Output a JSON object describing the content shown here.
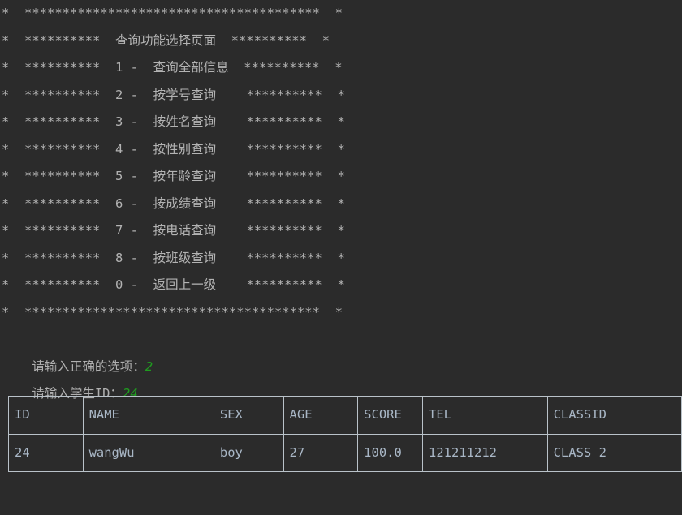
{
  "console": {
    "theme": {
      "background": "#2b2b2b",
      "foreground": "#b3b3b3",
      "input_value_color": "#1f9c1f",
      "table_border_color": "#b9c2c9"
    },
    "border_top": "*  ***************************************  *",
    "border_bottom": "*  ***************************************  *",
    "title_line": "*  **********  查询功能选择页面  **********  *",
    "menu_lines": [
      "*  **********  1 -  查询全部信息  **********  *",
      "*  **********  2 -  按学号查询    **********  *",
      "*  **********  3 -  按姓名查询    **********  *",
      "*  **********  4 -  按性别查询    **********  *",
      "*  **********  5 -  按年龄查询    **********  *",
      "*  **********  6 -  按成绩查询    **********  *",
      "*  **********  7 -  按电话查询    **********  *",
      "*  **********  8 -  按班级查询    **********  *",
      "*  **********  0 -  返回上一级    **********  *"
    ],
    "menu": {
      "title": "查询功能选择页面",
      "items": [
        {
          "key": "1",
          "label": "查询全部信息"
        },
        {
          "key": "2",
          "label": "按学号查询"
        },
        {
          "key": "3",
          "label": "按姓名查询"
        },
        {
          "key": "4",
          "label": "按性别查询"
        },
        {
          "key": "5",
          "label": "按年龄查询"
        },
        {
          "key": "6",
          "label": "按成绩查询"
        },
        {
          "key": "7",
          "label": "按电话查询"
        },
        {
          "key": "8",
          "label": "按班级查询"
        },
        {
          "key": "0",
          "label": "返回上一级"
        }
      ]
    },
    "prompts": [
      {
        "label": "请输入正确的选项：",
        "value": "2"
      },
      {
        "label": "请输入学生ID：",
        "value": "24"
      }
    ]
  },
  "table": {
    "headers": [
      "ID",
      "NAME",
      "SEX",
      "AGE",
      "SCORE",
      "TEL",
      "CLASSID"
    ],
    "rows": [
      [
        "24",
        "wangWu",
        "boy",
        "27",
        "100.0",
        "121211212",
        "CLASS 2"
      ]
    ]
  }
}
